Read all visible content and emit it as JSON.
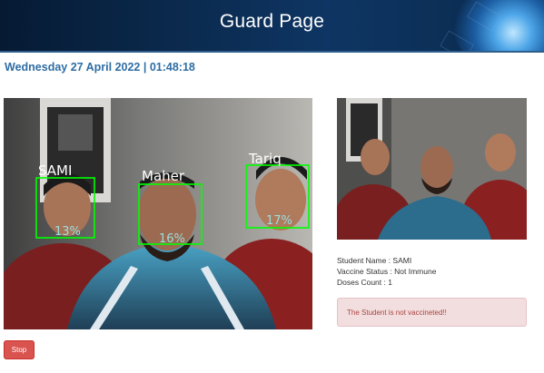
{
  "header": {
    "title": "Guard Page"
  },
  "datetime": "Wednesday 27 April 2022 | 01:48:18",
  "detections": [
    {
      "name": "SAMI",
      "confidence": "13%"
    },
    {
      "name": "Maher",
      "confidence": "16%"
    },
    {
      "name": "Tariq",
      "confidence": "17%"
    }
  ],
  "student": {
    "name_line": "Student Name : SAMI",
    "status_line": "Vaccine Status : Not Immune",
    "doses_line": "Doses Count : 1"
  },
  "alert": "The Student is not vaccineted!!",
  "controls": {
    "stop_label": "Stop"
  },
  "colors": {
    "accent": "#2e6da4",
    "detection_box": "#00ff00",
    "danger": "#d9534f"
  }
}
